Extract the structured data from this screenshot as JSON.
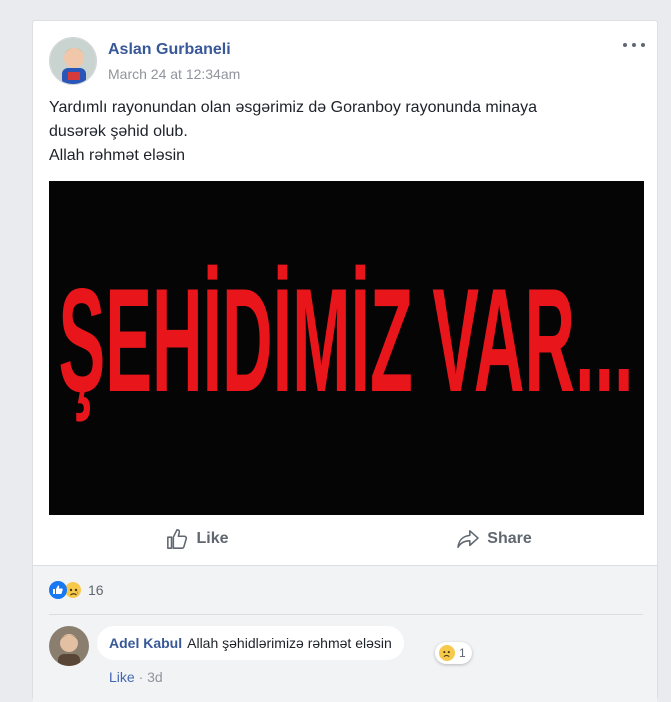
{
  "post": {
    "author": "Aslan Gurbaneli",
    "timestamp": "March 24 at 12:34am",
    "text_lines": [
      "Yardımlı rayonundan olan əsgərimiz də Goranboy rayonunda minaya",
      "dusərək şəhid olub.",
      "Allah rəhmət eləsin"
    ],
    "image_text": "ŞEHİDİMİZ VAR...",
    "image_text_color": "#e8151b"
  },
  "actions": {
    "like_label": "Like",
    "share_label": "Share"
  },
  "reactions": {
    "count": "16",
    "types": [
      "like-icon",
      "sad-icon"
    ]
  },
  "comment": {
    "author": "Adel Kabul",
    "text": "Allah şəhidlərimizə rəhmət eləsin",
    "reaction_count": "1",
    "like_label": "Like",
    "separator": "·",
    "age": "3d"
  },
  "colors": {
    "link_blue": "#385898",
    "muted": "#90949c",
    "background": "#e9ebee"
  }
}
